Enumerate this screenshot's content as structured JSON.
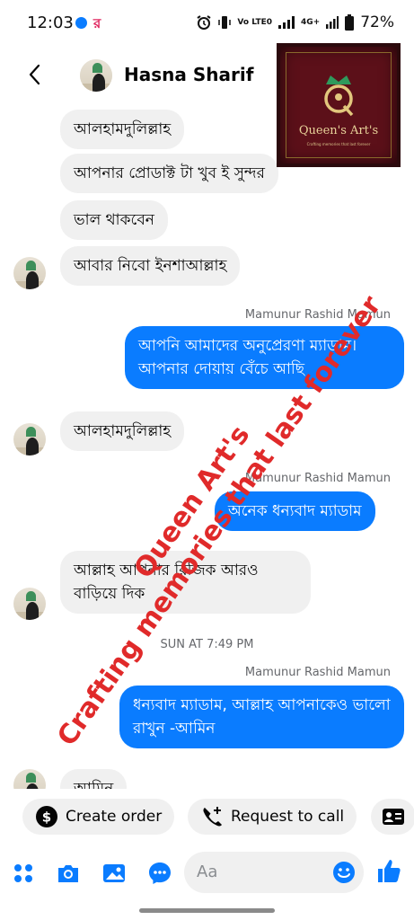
{
  "status_bar": {
    "time": "12:03",
    "chat_glyph": "র",
    "network_label": "Vo LTE0",
    "network_4g": "4G+",
    "battery": "72%"
  },
  "header": {
    "contact_name": "Hasna Sharif"
  },
  "logo": {
    "title": "Queen's Art's",
    "tagline": "Crafting memories that last forever"
  },
  "messages": [
    {
      "text": "আলহামদুলিল্লাহ"
    },
    {
      "text": "আপনার প্রোডাক্ট টা খুব ই সুন্দর"
    },
    {
      "text": "ভাল থাকবেন"
    },
    {
      "text": "আবার নিবো ইনশাআল্লাহ"
    },
    {
      "sender": "Mamunur Rashid Mamun",
      "text": "আপনি আমাদের অনুপ্রেরণা ম্যাডাম। আপনার দোয়ায় বেঁচে আছি"
    },
    {
      "text": "আলহামদুলিল্লাহ"
    },
    {
      "sender": "Mamunur Rashid Mamun",
      "text": "অনেক ধন্যবাদ ম্যাডাম"
    },
    {
      "text": "আল্লাহ আপনার রিজিক আরও বাড়িয়ে দিক"
    },
    {
      "timestamp": "SUN AT 7:49 PM"
    },
    {
      "sender": "Mamunur Rashid Mamun",
      "text": "ধন্যবাদ ম্যাডাম, আল্লাহ আপনাকেও ভালো রাখুন -আমিন"
    },
    {
      "text": "আমিন"
    }
  ],
  "watermark": {
    "line1": "Queen Art's",
    "line2": "Crafting memories that last forever"
  },
  "quick_actions": {
    "create_order": "Create order",
    "request_call": "Request to call"
  },
  "composer": {
    "placeholder": "Aa"
  },
  "colors": {
    "accent": "#0a7cff",
    "incoming_bg": "#f0f0f0",
    "watermark": "#e02a2a",
    "logo_bg": "#5c1019"
  }
}
